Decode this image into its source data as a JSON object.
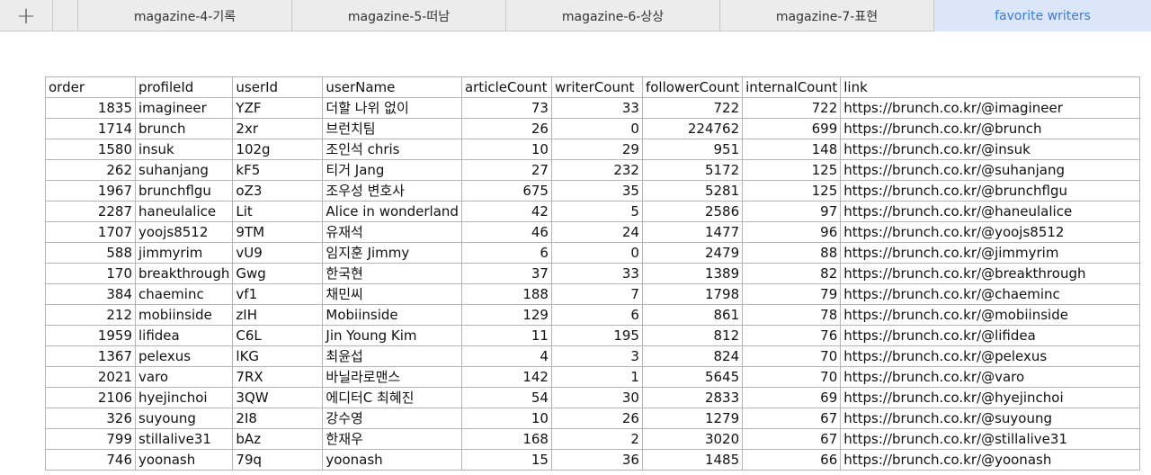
{
  "tabs": {
    "add_symbol": "+",
    "items": [
      {
        "label": "magazine-4-기록",
        "active": false
      },
      {
        "label": "magazine-5-떠남",
        "active": false
      },
      {
        "label": "magazine-6-상상",
        "active": false
      },
      {
        "label": "magazine-7-표현",
        "active": false
      },
      {
        "label": "favorite writers",
        "active": true
      }
    ]
  },
  "sheet": {
    "headers": [
      "order",
      "profileId",
      "userId",
      "userName",
      "articleCount",
      "writerCount",
      "followerCount",
      "internalCount",
      "link"
    ],
    "rows": [
      [
        "1835",
        "imagineer",
        "YZF",
        "더할 나위 없이",
        "73",
        "33",
        "722",
        "722",
        "https://brunch.co.kr/@imagineer"
      ],
      [
        "1714",
        "brunch",
        "2xr",
        "브런치팀",
        "26",
        "0",
        "224762",
        "699",
        "https://brunch.co.kr/@brunch"
      ],
      [
        "1580",
        "insuk",
        "102g",
        "조인석 chris",
        "10",
        "29",
        "951",
        "148",
        "https://brunch.co.kr/@insuk"
      ],
      [
        "262",
        "suhanjang",
        "kF5",
        "티거 Jang",
        "27",
        "232",
        "5172",
        "125",
        "https://brunch.co.kr/@suhanjang"
      ],
      [
        "1967",
        "brunchflgu",
        "oZ3",
        "조우성 변호사",
        "675",
        "35",
        "5281",
        "125",
        "https://brunch.co.kr/@brunchflgu"
      ],
      [
        "2287",
        "haneulalice",
        "Lit",
        "Alice in wonderland",
        "42",
        "5",
        "2586",
        "97",
        "https://brunch.co.kr/@haneulalice"
      ],
      [
        "1707",
        "yoojs8512",
        "9TM",
        "유재석",
        "46",
        "24",
        "1477",
        "96",
        "https://brunch.co.kr/@yoojs8512"
      ],
      [
        "588",
        "jimmyrim",
        "vU9",
        "임지훈 Jimmy",
        "6",
        "0",
        "2479",
        "88",
        "https://brunch.co.kr/@jimmyrim"
      ],
      [
        "170",
        "breakthrough",
        "Gwg",
        "한국현",
        "37",
        "33",
        "1389",
        "82",
        "https://brunch.co.kr/@breakthrough"
      ],
      [
        "384",
        "chaeminc",
        "vf1",
        "채민씨",
        "188",
        "7",
        "1798",
        "79",
        "https://brunch.co.kr/@chaeminc"
      ],
      [
        "212",
        "mobiinside",
        "zIH",
        "Mobiinside",
        "129",
        "6",
        "861",
        "78",
        "https://brunch.co.kr/@mobiinside"
      ],
      [
        "1959",
        "lifidea",
        "C6L",
        "Jin Young Kim",
        "11",
        "195",
        "812",
        "76",
        "https://brunch.co.kr/@lifidea"
      ],
      [
        "1367",
        "pelexus",
        "lKG",
        "최윤섭",
        "4",
        "3",
        "824",
        "70",
        "https://brunch.co.kr/@pelexus"
      ],
      [
        "2021",
        "varo",
        "7RX",
        "바닐라로맨스",
        "142",
        "1",
        "5645",
        "70",
        "https://brunch.co.kr/@varo"
      ],
      [
        "2106",
        "hyejinchoi",
        "3QW",
        "에디터C 최혜진",
        "54",
        "30",
        "2833",
        "69",
        "https://brunch.co.kr/@hyejinchoi"
      ],
      [
        "326",
        "suyoung",
        "2I8",
        "강수영",
        "10",
        "26",
        "1279",
        "67",
        "https://brunch.co.kr/@suyoung"
      ],
      [
        "799",
        "stillalive31",
        "bAz",
        "한재우",
        "168",
        "2",
        "3020",
        "67",
        "https://brunch.co.kr/@stillalive31"
      ],
      [
        "746",
        "yoonash",
        "79q",
        "yoonash",
        "15",
        "36",
        "1485",
        "66",
        "https://brunch.co.kr/@yoonash"
      ]
    ]
  }
}
